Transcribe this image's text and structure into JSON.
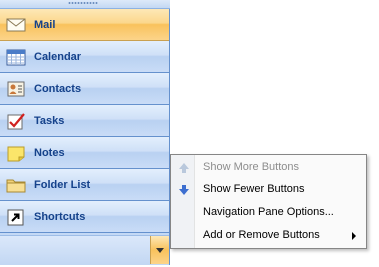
{
  "nav": {
    "buttons": [
      {
        "label": "Mail",
        "icon": "mail-icon",
        "active": true
      },
      {
        "label": "Calendar",
        "icon": "calendar-icon"
      },
      {
        "label": "Contacts",
        "icon": "contacts-icon"
      },
      {
        "label": "Tasks",
        "icon": "tasks-icon"
      },
      {
        "label": "Notes",
        "icon": "notes-icon"
      },
      {
        "label": "Folder List",
        "icon": "folder-icon"
      },
      {
        "label": "Shortcuts",
        "icon": "shortcut-icon"
      }
    ],
    "configure_icon": "chevron-down-icon"
  },
  "menu": {
    "items": [
      {
        "label": "Show More Buttons",
        "icon": "up-arrow-icon",
        "enabled": false
      },
      {
        "label": "Show Fewer Buttons",
        "icon": "down-arrow-icon",
        "enabled": true
      },
      {
        "label": "Navigation Pane Options...",
        "enabled": true
      },
      {
        "label": "Add or Remove Buttons",
        "has_submenu": true,
        "enabled": true
      }
    ]
  },
  "colors": {
    "accent_active": "#f9c25c",
    "nav_text": "#15428b",
    "pane_blue": "#c4d9f5"
  }
}
